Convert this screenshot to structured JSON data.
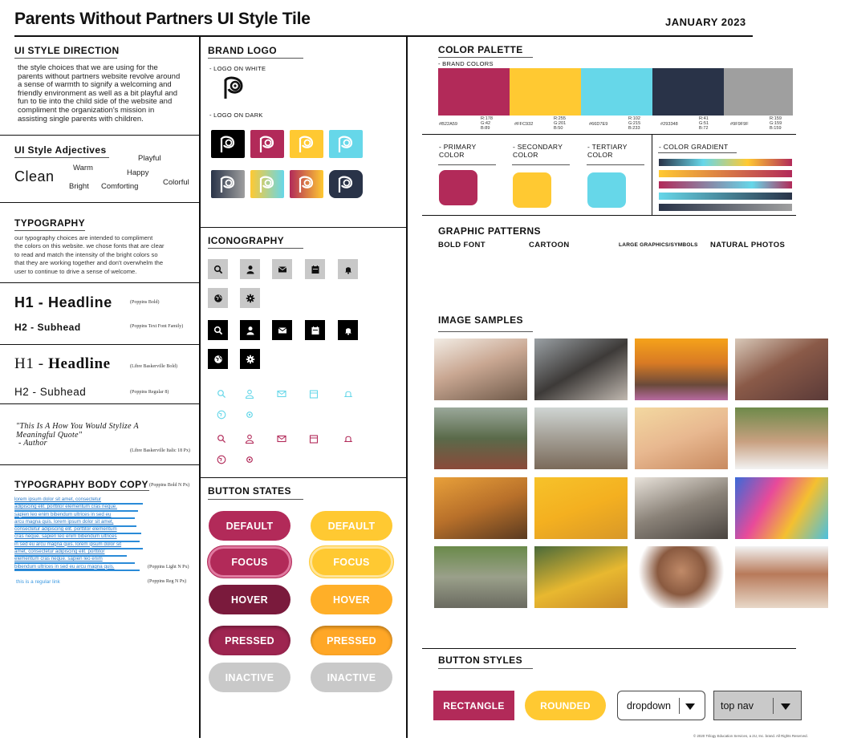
{
  "header": {
    "title": "Parents Without Partners UI Style Tile",
    "date": "JANUARY 2023"
  },
  "style_direction": {
    "heading": "UI STYLE DIRECTION",
    "lines": [
      "the style choices that we are using for the",
      "parents without partners website revolve around",
      "a sense of warmth to signify a welcoming and",
      "friendly environment as well as a bit playful and",
      "fun to tie into the child side of the website and",
      "compliment the organization's mission in",
      "assisting single parents with children."
    ]
  },
  "adjectives": {
    "heading": "UI Style Adjectives",
    "items": {
      "clean": "Clean",
      "warm": "Warm",
      "playful": "Playful",
      "happy": "Happy",
      "colorful": "Colorful",
      "bright": "Bright",
      "comforting": "Comforting"
    }
  },
  "typography": {
    "heading": "TYPOGRAPHY",
    "lines": [
      "our typography choices are intended to compliment",
      "the colors on this website. we chose fonts that are clear",
      "to read and match the intensity of the bright colors so",
      "that they are working together and don't overwhelm the",
      "user to continue to drive a sense of welcome."
    ],
    "h1_poppins": "H1 - Headline",
    "h1_poppins_note": "(Poppins Bold)",
    "h2_poppins": "H2 - Subhead",
    "h2_poppins_note": "(Poppins Text Font Family)",
    "h1_libre_prefix": "H1 - ",
    "h1_libre_main": "Headline",
    "h1_libre_note": "(Libre Baskerville Bold)",
    "h2_libre": "H2 - Subhead",
    "h2_libre_note": "(Poppins Regular 8)",
    "quote_line1": "\"This Is A How You Would Stylize A",
    "quote_line2": "Meaningful Quote\"",
    "quote_author": "- Author",
    "quote_note": "(Libre Baskerville Italic 18 Px)"
  },
  "body_copy": {
    "heading": "TYPOGRAPHY BODY COPY",
    "heading_note": "(Poppins  Bold N Px)",
    "link_lines": [
      "lorem ipsum dolor sit amet, consectetur",
      "adipiscing elit. porttitor elementum cras neque.",
      "sapien leo enim bibendum ultrices in sed eu",
      "arcu magna quis. lorem ipsum dolor sit amet,",
      "consectetur adipiscing elit. porttitor elementum",
      "cras neque. sapien leo enim bibendum ultrices",
      "in sed eu arcu magna quis. lorem ipsum dolor sit",
      "amet, consectetur adipiscing elit. porttitor",
      "elementum cras neque. sapien leo enim",
      "bibendum ultrices in sed eu arcu magna quis."
    ],
    "light_note": "(Poppins  Light N Px)",
    "regular_link": "this is a regular link",
    "regular_note": "(Poppins  Reg N Px)"
  },
  "brand_logo": {
    "heading": "BRAND LOGO",
    "on_white": "- LOGO ON WHITE",
    "on_dark": "- LOGO ON DARK"
  },
  "iconography": {
    "heading": "ICONOGRAPHY"
  },
  "button_states": {
    "heading": "BUTTON STATES",
    "labels": {
      "default": "DEFAULT",
      "focus": "FOCUS",
      "hover": "HOVER",
      "pressed": "PRESSED",
      "inactive": "INACTIVE"
    }
  },
  "color_palette": {
    "heading": "COLOR PALETTE",
    "brand_label": "- BRAND COLORS",
    "swatches": [
      {
        "hex": "#B22A59",
        "r": "R:178",
        "g": "G:42",
        "b": "B:89"
      },
      {
        "hex": "#FFC932",
        "r": "R:255",
        "g": "G:201",
        "b": "B:50"
      },
      {
        "hex": "#66D7E9",
        "r": "R:102",
        "g": "G:215",
        "b": "B:233"
      },
      {
        "hex": "#293348",
        "r": "R:41",
        "g": "G:51",
        "b": "B:72"
      },
      {
        "hex": "#9F9F9F",
        "r": "R:159",
        "g": "G:159",
        "b": "B:159"
      }
    ],
    "primary": {
      "l1": "- PRIMARY",
      "l2": "COLOR"
    },
    "secondary": {
      "l1": "- SECONDARY",
      "l2": "COLOR"
    },
    "tertiary": {
      "l1": "- TERTIARY",
      "l2": "COLOR"
    },
    "gradient": "- COLOR GRADIENT"
  },
  "graphic_patterns": {
    "heading": "GRAPHIC PATTERNS",
    "bold_font": "BOLD FONT",
    "cartoon": "CARTOON",
    "large_graphics": "LARGE GRAPHICS/SYMBOLS",
    "natural_photos": "NATURAL PHOTOS"
  },
  "image_samples": {
    "heading": "IMAGE SAMPLES"
  },
  "button_styles": {
    "heading": "BUTTON STYLES",
    "rectangle": "RECTANGLE",
    "rounded": "ROUNDED",
    "dropdown": "dropdown",
    "top_nav": "top nav"
  },
  "footer": {
    "copyright": "© 2020 Trilogy Education Services, a 2U, Inc. brand. All Rights Reserved."
  },
  "colors": {
    "primary": "#B22A59",
    "secondary": "#FFC932",
    "tertiary": "#66D7E9",
    "dark": "#293348",
    "gray": "#9F9F9F"
  }
}
